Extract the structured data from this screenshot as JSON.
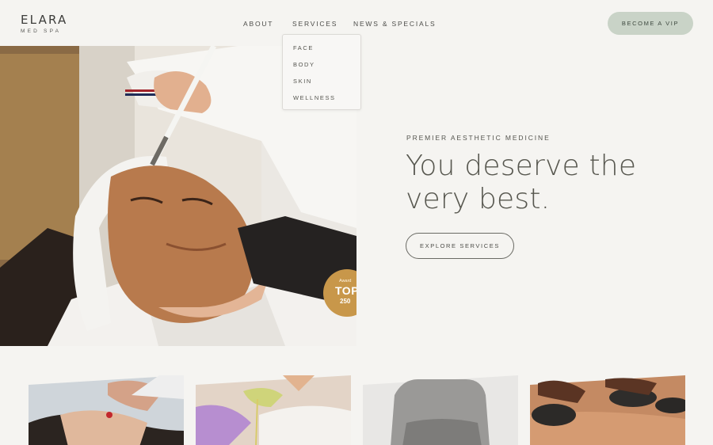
{
  "brand": {
    "name": "ELARA",
    "tagline": "MED SPA"
  },
  "nav": {
    "items": [
      "ABOUT",
      "SERVICES",
      "NEWS & SPECIALS"
    ],
    "cta": "BECOME A VIP"
  },
  "services_menu": {
    "items": [
      "FACE",
      "BODY",
      "SKIN",
      "WELLNESS"
    ]
  },
  "hero": {
    "eyebrow": "PREMIER AESTHETIC MEDICINE",
    "headline_line1": "You deserve the",
    "headline_line2": "very best.",
    "button": "EXPLORE SERVICES",
    "badge": {
      "small": "Award",
      "title": "TOP",
      "number": "250",
      "color": "#c8974a"
    }
  },
  "colors": {
    "background": "#f5f4f1",
    "vip_button": "#c9d3c7",
    "text": "#4a4a48"
  }
}
